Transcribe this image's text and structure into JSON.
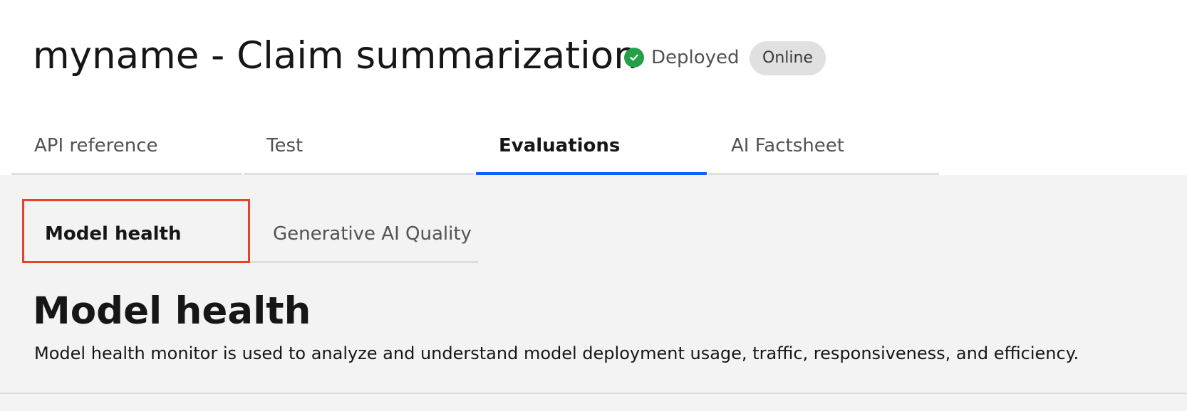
{
  "header": {
    "title": "myname - Claim summarization",
    "status_label": "Deployed",
    "status_color": "#24a148",
    "status_icon": "checkmark-circle-icon",
    "badge_label": "Online"
  },
  "tabs": [
    {
      "label": "API reference",
      "selected": false
    },
    {
      "label": "Test",
      "selected": false
    },
    {
      "label": "Evaluations",
      "selected": true
    },
    {
      "label": "AI Factsheet",
      "selected": false
    }
  ],
  "subtabs": [
    {
      "label": "Model health",
      "selected": true
    },
    {
      "label": "Generative AI Quality",
      "selected": false
    }
  ],
  "section": {
    "title": "Model health",
    "description": "Model health monitor is used to analyze and understand model deployment usage, traffic, responsiveness, and efficiency."
  },
  "colors": {
    "accent": "#0f62fe",
    "highlight_border": "#e5432a",
    "content_background": "#f3f3f3"
  }
}
